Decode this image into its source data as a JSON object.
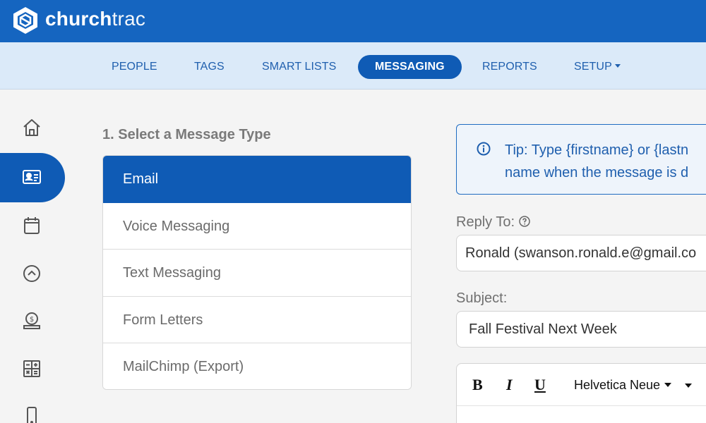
{
  "brand": {
    "name_bold": "church",
    "name_light": "trac"
  },
  "nav": {
    "items": [
      {
        "label": "PEOPLE"
      },
      {
        "label": "TAGS"
      },
      {
        "label": "SMART LISTS"
      },
      {
        "label": "MESSAGING",
        "active": true
      },
      {
        "label": "REPORTS"
      },
      {
        "label": "SETUP"
      }
    ]
  },
  "rail": {
    "icons": [
      "home-icon",
      "contact-card-icon",
      "calendar-icon",
      "chevron-up-circle-icon",
      "giving-icon",
      "grid-calculator-icon",
      "mobile-icon"
    ],
    "active_index": 1
  },
  "main": {
    "section_title": "1. Select a Message Type",
    "message_types": [
      {
        "label": "Email",
        "active": true
      },
      {
        "label": "Voice Messaging"
      },
      {
        "label": "Text Messaging"
      },
      {
        "label": "Form Letters"
      },
      {
        "label": "MailChimp (Export)"
      }
    ]
  },
  "tip": {
    "icon": "info-icon",
    "line1": "Tip: Type {firstname} or {lastn",
    "line2": "name when the message is d"
  },
  "form": {
    "reply_to_label": "Reply To:",
    "reply_to_value": "Ronald (swanson.ronald.e@gmail.co",
    "subject_label": "Subject:",
    "subject_value": "Fall Festival Next Week"
  },
  "editor": {
    "bold": "B",
    "italic": "I",
    "underline": "U",
    "font": "Helvetica Neue"
  },
  "colors": {
    "brand_blue": "#1565c0",
    "active_blue": "#0f5bb5",
    "subnav_bg": "#dbeaf9",
    "nav_text": "#1f5fae"
  }
}
